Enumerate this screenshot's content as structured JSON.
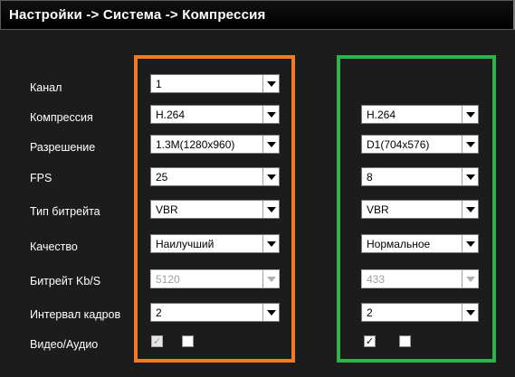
{
  "header": {
    "title": "Настройки -> Система -> Компрессия"
  },
  "labels": {
    "channel": "Канал",
    "compression": "Компрессия",
    "resolution": "Разрешение",
    "fps": "FPS",
    "bitrate_type": "Тип битрейта",
    "quality": "Качество",
    "bitrate": "Битрейт Kb/S",
    "frame_interval": "Интервал кадров",
    "video_audio": "Видео/Аудио"
  },
  "main_stream": {
    "channel": "1",
    "compression": "H.264",
    "resolution": "1.3M(1280x960)",
    "fps": "25",
    "bitrate_type": "VBR",
    "quality": "Наилучший",
    "bitrate": "5120",
    "frame_interval": "2",
    "video_checked": true,
    "audio_checked": false
  },
  "extra_stream": {
    "compression": "H.264",
    "resolution": "D1(704x576)",
    "fps": "8",
    "bitrate_type": "VBR",
    "quality": "Нормальное",
    "bitrate": "433",
    "frame_interval": "2",
    "video_checked": true,
    "audio_checked": false
  },
  "colors": {
    "main_frame": "#ee7a2a",
    "extra_frame": "#2fb24a"
  },
  "icons": {
    "dropdown": "triangle-down-glyph",
    "checkmark": "✓"
  }
}
